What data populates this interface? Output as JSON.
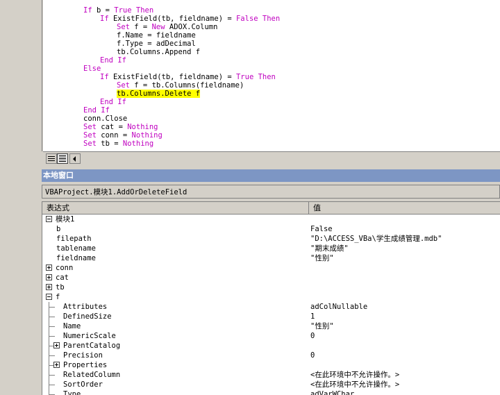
{
  "code": {
    "lines": [
      {
        "indent": 0,
        "parts": [
          {
            "t": "If",
            "kw": true
          },
          {
            "t": " b = "
          },
          {
            "t": "True Then",
            "kw": true
          }
        ]
      },
      {
        "indent": 1,
        "parts": [
          {
            "t": "If",
            "kw": true
          },
          {
            "t": " ExistField(tb, fieldname) = "
          },
          {
            "t": "False Then",
            "kw": true
          }
        ]
      },
      {
        "indent": 2,
        "parts": [
          {
            "t": "Set",
            "kw": true
          },
          {
            "t": " f = "
          },
          {
            "t": "New",
            "kw": true
          },
          {
            "t": " ADOX.Column"
          }
        ]
      },
      {
        "indent": 2,
        "parts": [
          {
            "t": "f.Name = fieldname"
          }
        ]
      },
      {
        "indent": 2,
        "parts": [
          {
            "t": "f.Type = adDecimal"
          }
        ]
      },
      {
        "indent": 2,
        "parts": [
          {
            "t": "tb.Columns.Append f"
          }
        ]
      },
      {
        "indent": 1,
        "parts": [
          {
            "t": "End If",
            "kw": true
          }
        ]
      },
      {
        "indent": 0,
        "parts": [
          {
            "t": "Else",
            "kw": true
          }
        ]
      },
      {
        "indent": 1,
        "parts": [
          {
            "t": "If",
            "kw": true
          },
          {
            "t": " ExistField(tb, fieldname) = "
          },
          {
            "t": "True Then",
            "kw": true
          }
        ]
      },
      {
        "indent": 2,
        "parts": [
          {
            "t": "Set",
            "kw": true
          },
          {
            "t": " f = tb.Columns(fieldname)"
          }
        ]
      },
      {
        "indent": 2,
        "parts": [
          {
            "t": "tb.Columns.Delete f",
            "hl": true
          }
        ]
      },
      {
        "indent": 1,
        "parts": [
          {
            "t": "End If",
            "kw": true
          }
        ]
      },
      {
        "indent": 0,
        "parts": [
          {
            "t": "End If",
            "kw": true
          }
        ]
      },
      {
        "indent": 0,
        "parts": [
          {
            "t": "conn.Close"
          }
        ]
      },
      {
        "indent": 0,
        "parts": [
          {
            "t": "Set",
            "kw": true
          },
          {
            "t": " cat = "
          },
          {
            "t": "Nothing",
            "kw": true
          }
        ]
      },
      {
        "indent": 0,
        "parts": [
          {
            "t": "Set",
            "kw": true
          },
          {
            "t": " conn = "
          },
          {
            "t": "Nothing",
            "kw": true
          }
        ]
      },
      {
        "indent": 0,
        "parts": [
          {
            "t": "Set",
            "kw": true
          },
          {
            "t": " tb = "
          },
          {
            "t": "Nothing",
            "kw": true
          }
        ]
      }
    ],
    "current_line_index": 10,
    "keyword_color": "#c000c0",
    "highlight_color": "#ffff00"
  },
  "locals": {
    "title": "本地窗口",
    "context": "VBAProject.模块1.AddOrDeleteField",
    "headers": {
      "expression": "表达式",
      "value": "值"
    },
    "rows": [
      {
        "level": 0,
        "toggle": "minus",
        "name": "模块1",
        "value": ""
      },
      {
        "level": 1,
        "toggle": "",
        "name": "b",
        "value": "False"
      },
      {
        "level": 1,
        "toggle": "",
        "name": "filepath",
        "value": "\"D:\\ACCESS_VBa\\学生成绩管理.mdb\""
      },
      {
        "level": 1,
        "toggle": "",
        "name": "tablename",
        "value": "\"期末成绩\""
      },
      {
        "level": 1,
        "toggle": "",
        "name": "fieldname",
        "value": "\"性别\""
      },
      {
        "level": 0,
        "toggle": "plus",
        "name": "conn",
        "value": ""
      },
      {
        "level": 0,
        "toggle": "plus",
        "name": "cat",
        "value": ""
      },
      {
        "level": 0,
        "toggle": "plus",
        "name": "tb",
        "value": ""
      },
      {
        "level": 0,
        "toggle": "minus",
        "name": "f",
        "value": ""
      },
      {
        "level": 2,
        "toggle": "",
        "name": "Attributes",
        "value": "adColNullable"
      },
      {
        "level": 2,
        "toggle": "",
        "name": "DefinedSize",
        "value": "1"
      },
      {
        "level": 2,
        "toggle": "",
        "name": "Name",
        "value": "\"性别\""
      },
      {
        "level": 2,
        "toggle": "",
        "name": "NumericScale",
        "value": "0"
      },
      {
        "level": 2,
        "toggle": "plus",
        "name": "ParentCatalog",
        "value": ""
      },
      {
        "level": 2,
        "toggle": "",
        "name": "Precision",
        "value": "0"
      },
      {
        "level": 2,
        "toggle": "plus",
        "name": "Properties",
        "value": ""
      },
      {
        "level": 2,
        "toggle": "",
        "name": "RelatedColumn",
        "value": "<在此环境中不允许操作。>"
      },
      {
        "level": 2,
        "toggle": "",
        "name": "SortOrder",
        "value": "<在此环境中不允许操作。>"
      },
      {
        "level": 2,
        "toggle": "",
        "name": "Type",
        "value": "adVarWChar"
      }
    ]
  },
  "icons": {
    "exec_arrow": "current-statement-arrow-icon",
    "procedure_view": "procedure-view-icon",
    "full_module_view": "full-module-view-icon"
  }
}
